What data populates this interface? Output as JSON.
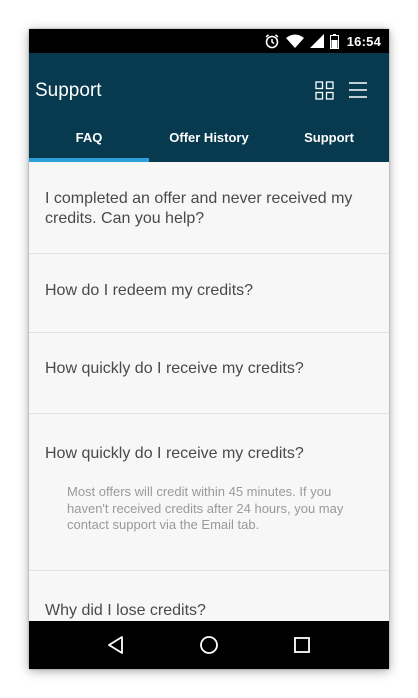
{
  "status_bar": {
    "time": "16:54",
    "icons": [
      "alarm-icon",
      "wifi-icon",
      "signal-icon",
      "battery-icon"
    ]
  },
  "app_bar": {
    "title": "Support",
    "actions": [
      "grid-icon",
      "menu-icon"
    ],
    "background": "#07394f"
  },
  "tabs": [
    {
      "label": "FAQ",
      "active": true
    },
    {
      "label": "Offer History",
      "active": false
    },
    {
      "label": "Support",
      "active": false
    }
  ],
  "accent_color": "#2a9fd8",
  "faq": [
    {
      "question": "I completed an offer and never received my credits. Can you help?"
    },
    {
      "question": "How do I redeem my credits?"
    },
    {
      "question": "How quickly do I receive my credits?"
    },
    {
      "question": "How quickly do I receive my credits?",
      "answer": "Most offers will credit within 45 minutes. If you haven't received credits after 24 hours, you may contact support via the Email tab."
    },
    {
      "question": "Why did I lose credits?"
    }
  ],
  "nav_bar": {
    "buttons": [
      "back-icon",
      "home-icon",
      "recents-icon"
    ]
  }
}
